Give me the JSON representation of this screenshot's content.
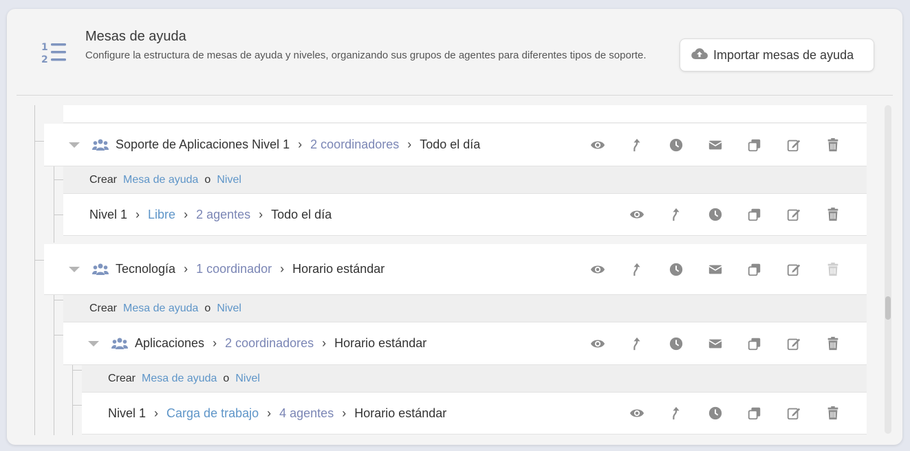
{
  "header": {
    "title": "Mesas de ayuda",
    "subtitle": "Configure la estructura de mesas de ayuda y niveles, organizando sus grupos de agentes para diferentes tipos de soporte.",
    "import_label": "Importar mesas de ayuda"
  },
  "create": {
    "label": "Crear",
    "helpdesk": "Mesa de ayuda",
    "or": "o",
    "level": "Nivel"
  },
  "sep": "›",
  "rows": {
    "soporte": {
      "name": "Soporte de Aplicaciones Nivel 1",
      "coordinators": "2 coordinadores",
      "schedule": "Todo el día"
    },
    "nivel1a": {
      "name": "Nivel 1",
      "mode": "Libre",
      "agents": "2 agentes",
      "schedule": "Todo el día"
    },
    "tecnologia": {
      "name": "Tecnología",
      "coordinators": "1 coordinador",
      "schedule": "Horario estándar"
    },
    "aplicaciones": {
      "name": "Aplicaciones",
      "coordinators": "2 coordinadores",
      "schedule": "Horario estándar"
    },
    "nivel1b": {
      "name": "Nivel 1",
      "mode": "Carga de trabajo",
      "agents": "4 agentes",
      "schedule": "Horario estándar"
    }
  },
  "colors": {
    "accent_link": "#5e95c8",
    "count_link": "#7b86b5",
    "icon_grey": "#8c8c8c",
    "icon_disabled": "#cfcfcf",
    "header_icon": "#7f95bf"
  }
}
